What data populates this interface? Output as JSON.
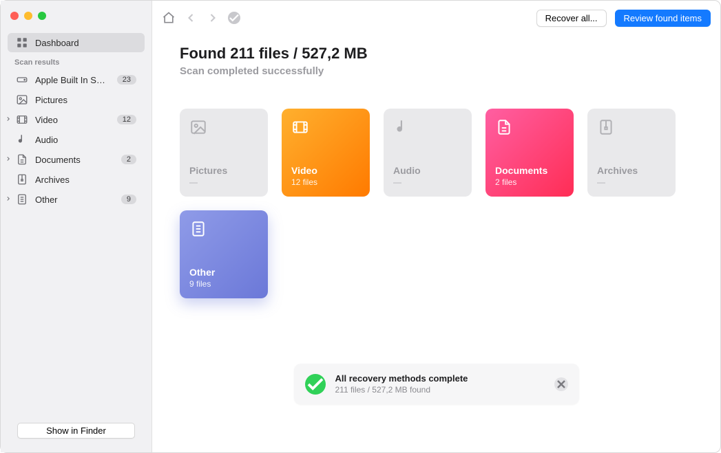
{
  "sidebar": {
    "dashboard_label": "Dashboard",
    "section_title": "Scan results",
    "items": [
      {
        "label": "Apple Built In SDX...",
        "badge": "23",
        "icon": "drive-icon",
        "disclosure": false
      },
      {
        "label": "Pictures",
        "badge": "",
        "icon": "picture-icon",
        "disclosure": false
      },
      {
        "label": "Video",
        "badge": "12",
        "icon": "video-icon",
        "disclosure": true
      },
      {
        "label": "Audio",
        "badge": "",
        "icon": "audio-icon",
        "disclosure": false
      },
      {
        "label": "Documents",
        "badge": "2",
        "icon": "document-icon",
        "disclosure": true
      },
      {
        "label": "Archives",
        "badge": "",
        "icon": "archive-icon",
        "disclosure": false
      },
      {
        "label": "Other",
        "badge": "9",
        "icon": "other-icon",
        "disclosure": true
      }
    ],
    "finder_button": "Show in Finder"
  },
  "toolbar": {
    "recover_label": "Recover all...",
    "review_label": "Review found items"
  },
  "content": {
    "headline": "Found 211 files / 527,2 MB",
    "subhead": "Scan completed successfully",
    "tiles": [
      {
        "title": "Pictures",
        "sub": "—",
        "style": "muted",
        "icon": "picture-icon"
      },
      {
        "title": "Video",
        "sub": "12 files",
        "style": "video",
        "icon": "video-icon"
      },
      {
        "title": "Audio",
        "sub": "—",
        "style": "muted",
        "icon": "audio-icon"
      },
      {
        "title": "Documents",
        "sub": "2 files",
        "style": "docs",
        "icon": "document-icon"
      },
      {
        "title": "Archives",
        "sub": "—",
        "style": "muted",
        "icon": "archive-icon"
      },
      {
        "title": "Other",
        "sub": "9 files",
        "style": "other",
        "icon": "other-icon"
      }
    ]
  },
  "toast": {
    "title": "All recovery methods complete",
    "sub": "211 files / 527,2 MB found"
  }
}
